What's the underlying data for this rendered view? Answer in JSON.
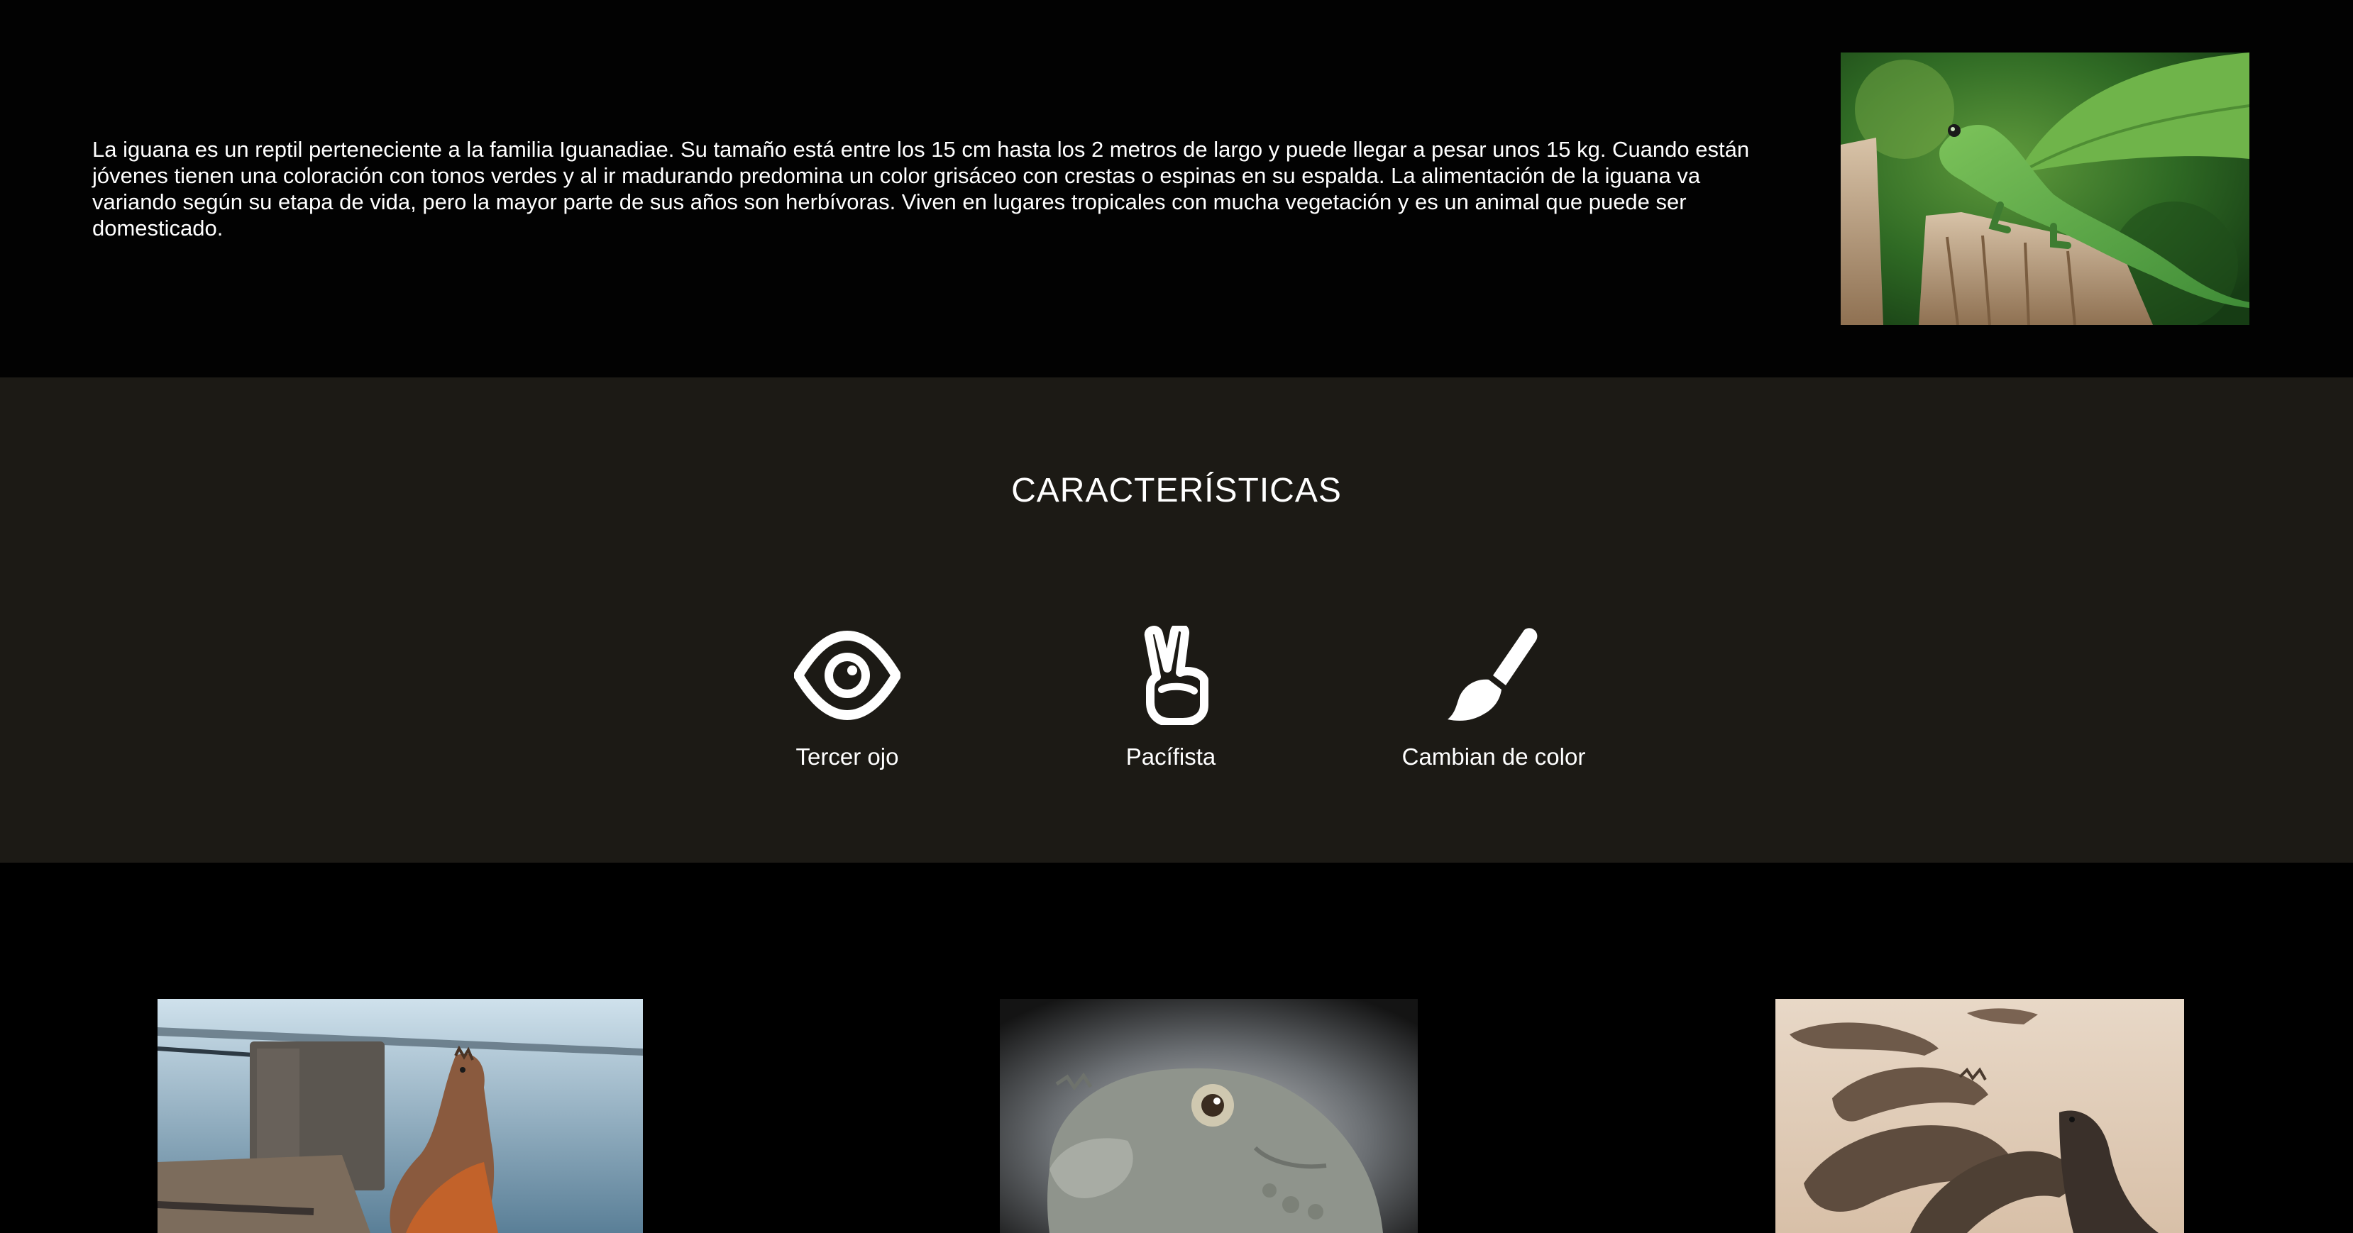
{
  "intro": {
    "text": "La iguana es un reptil perteneciente a la familia Iguanadiae. Su tamaño está entre los 15 cm hasta los 2 metros de largo y puede llegar a pesar unos 15 kg. Cuando están jóvenes tienen una coloración con tonos verdes y al ir madurando predomina un color grisáceo con crestas o espinas en su espalda. La alimentación de la iguana va variando según su etapa de vida, pero la mayor parte de sus años son herbívoras. Viven en lugares tropicales con mucha vegetación y es un animal que puede ser domesticado."
  },
  "features": {
    "title": "CARACTERÍSTICAS",
    "items": [
      {
        "label": "Tercer ojo",
        "icon": "eye-icon"
      },
      {
        "label": "Pacífista",
        "icon": "peace-hand-icon"
      },
      {
        "label": "Cambian de color",
        "icon": "paintbrush-icon"
      }
    ]
  },
  "colors": {
    "page_background": "#000000",
    "features_background": "#1c1a15",
    "text": "#ffffff"
  }
}
